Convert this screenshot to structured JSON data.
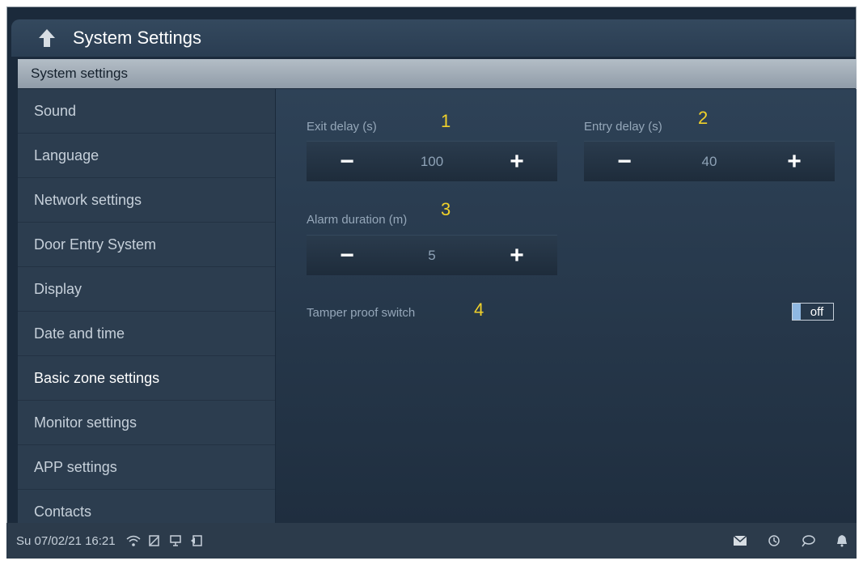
{
  "header": {
    "title": "System Settings"
  },
  "section": {
    "title": "System settings"
  },
  "sidebar": {
    "items": [
      {
        "label": "Sound"
      },
      {
        "label": "Language"
      },
      {
        "label": "Network settings"
      },
      {
        "label": "Door Entry System"
      },
      {
        "label": "Display"
      },
      {
        "label": "Date and time"
      },
      {
        "label": "Basic zone settings"
      },
      {
        "label": "Monitor settings"
      },
      {
        "label": "APP settings"
      },
      {
        "label": "Contacts"
      }
    ]
  },
  "settings": {
    "exit_delay": {
      "label": "Exit delay (s)",
      "value": "100",
      "marker": "1",
      "minus": "−",
      "plus": "+"
    },
    "entry_delay": {
      "label": "Entry delay (s)",
      "value": "40",
      "marker": "2",
      "minus": "−",
      "plus": "+"
    },
    "alarm_duration": {
      "label": "Alarm duration (m)",
      "value": "5",
      "marker": "3",
      "minus": "−",
      "plus": "+"
    },
    "tamper": {
      "label": "Tamper proof switch",
      "state": "off",
      "marker": "4"
    }
  },
  "status": {
    "datetime": "Su 07/02/21  16:21",
    "left_icons": [
      "wifi-icon",
      "note-icon",
      "monitor-icon",
      "return-icon"
    ],
    "right_icons": [
      "mail-icon",
      "history-icon",
      "chat-icon",
      "bell-icon"
    ]
  },
  "colors": {
    "accent": "#8fb8e2",
    "marker": "#f0d12a",
    "background": "#1b2a3b"
  }
}
